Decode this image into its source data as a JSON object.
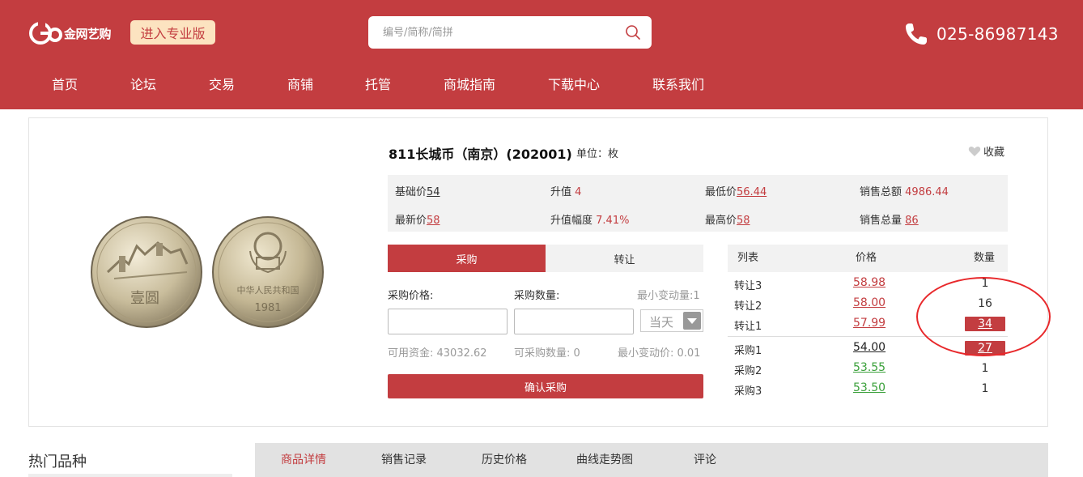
{
  "header": {
    "logo_text": "金网艺购",
    "pro_button": "进入专业版",
    "search_placeholder": "编号/简称/简拼",
    "phone": "025-86987143",
    "bg_color": "#c33d40"
  },
  "nav": {
    "items": [
      {
        "label": "首页"
      },
      {
        "label": "论坛"
      },
      {
        "label": "交易"
      },
      {
        "label": "商铺"
      },
      {
        "label": "托管"
      },
      {
        "label": "商城指南"
      },
      {
        "label": "下载中心"
      },
      {
        "label": "联系我们"
      }
    ]
  },
  "product": {
    "title": "811长城币（南京）(202001)",
    "unit": "单位：枚",
    "favorite_label": "收藏",
    "coin_front_text": "壹圆",
    "coin_back_text": "中华人民共和国",
    "coin_year": "1981",
    "stats": {
      "base_label": "基础价",
      "base_value": "54",
      "rise_label": "升值",
      "rise_value": "4",
      "low_label": "最低价",
      "low_value": "56.44",
      "sales_amount_label": "销售总额",
      "sales_amount_value": "4986.44",
      "latest_label": "最新价",
      "latest_value": "58",
      "rise_pct_label": "升值幅度",
      "rise_pct_value": "7.41%",
      "high_label": "最高价",
      "high_value": "58",
      "sales_qty_label": "销售总量",
      "sales_qty_value": "86"
    }
  },
  "trade": {
    "tab_buy": "采购",
    "tab_transfer": "转让",
    "price_label": "采购价格:",
    "qty_label": "采购数量:",
    "min_change_qty": "最小变动量:1",
    "day_option": "当天",
    "available_funds": "可用资金: 43032.62",
    "available_qty": "可采购数量: 0",
    "min_change_price": "最小变动价: 0.01",
    "confirm_button": "确认采购"
  },
  "orderbook": {
    "headers": {
      "list": "列表",
      "price": "价格",
      "qty": "数量"
    },
    "asks": [
      {
        "name": "转让3",
        "price": "58.98",
        "qty": "1"
      },
      {
        "name": "转让2",
        "price": "58.00",
        "qty": "16"
      },
      {
        "name": "转让1",
        "price": "57.99",
        "qty": "34"
      }
    ],
    "bids": [
      {
        "name": "采购1",
        "price": "54.00",
        "qty": "27"
      },
      {
        "name": "采购2",
        "price": "53.55",
        "qty": "1"
      },
      {
        "name": "采购3",
        "price": "53.50",
        "qty": "1"
      }
    ]
  },
  "bottom": {
    "hot_title": "热门品种",
    "detail_tabs": [
      {
        "label": "商品详情"
      },
      {
        "label": "销售记录"
      },
      {
        "label": "历史价格"
      },
      {
        "label": "曲线走势图"
      },
      {
        "label": "评论"
      }
    ]
  }
}
